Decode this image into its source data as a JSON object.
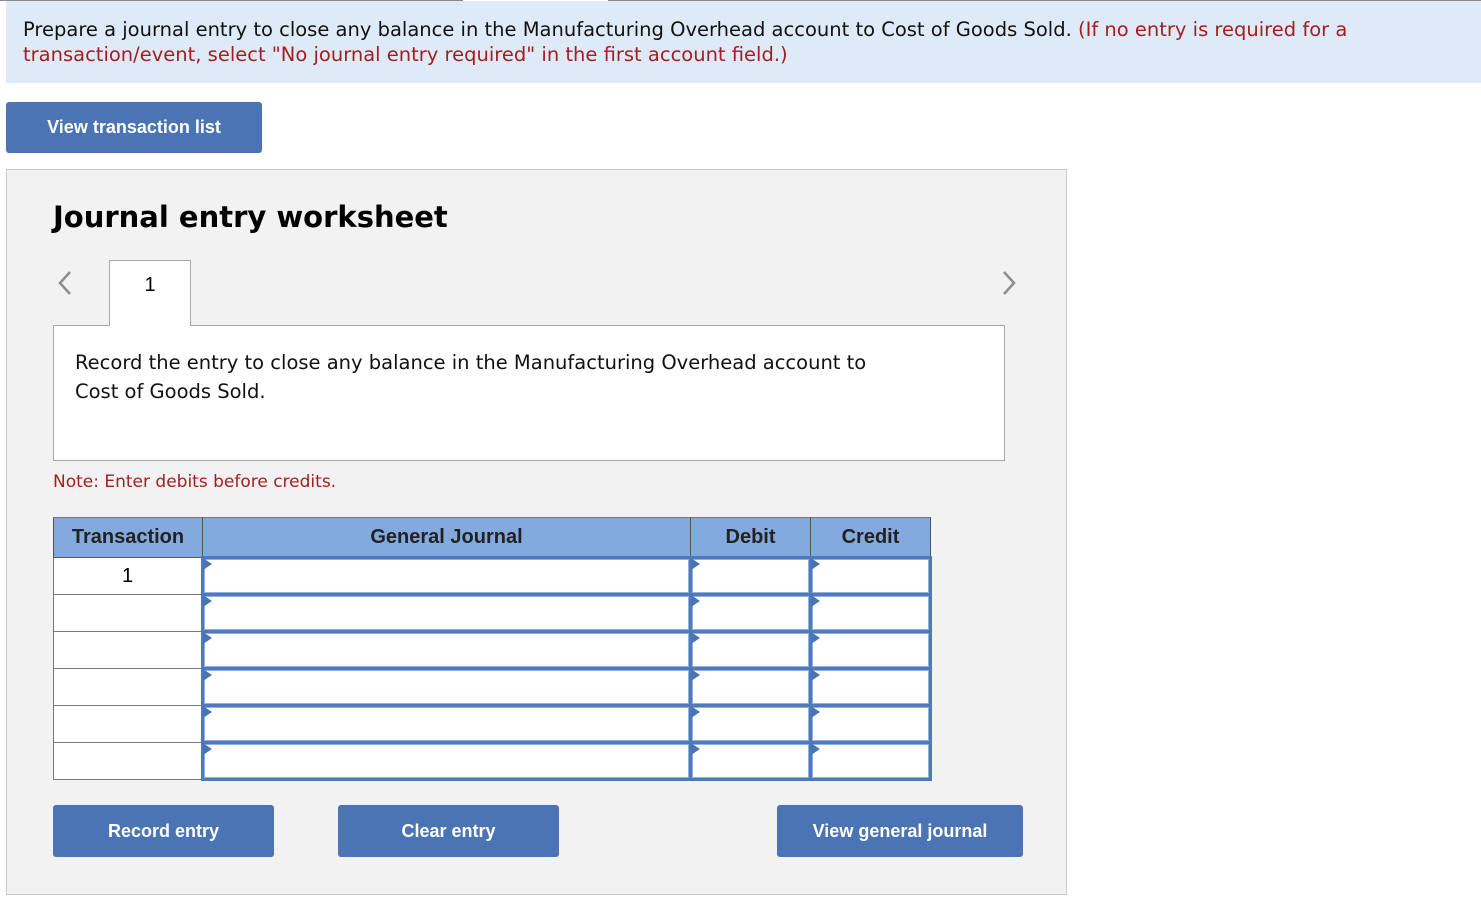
{
  "prompt": {
    "instruction": "Prepare a journal entry to close any balance in the Manufacturing Overhead account to Cost of Goods Sold.",
    "hint": "(If no entry is required for a transaction/event, select \"No journal entry required\" in the first account field.)"
  },
  "buttons": {
    "view_transaction_list": "View transaction list",
    "record_entry": "Record entry",
    "clear_entry": "Clear entry",
    "view_general_journal": "View general journal"
  },
  "worksheet": {
    "title": "Journal entry worksheet",
    "active_tab": "1",
    "description": "Record the entry to close any balance in the Manufacturing Overhead account to Cost of Goods Sold.",
    "note": "Note: Enter debits before credits."
  },
  "table": {
    "headers": [
      "Transaction",
      "General Journal",
      "Debit",
      "Credit"
    ],
    "rows": [
      {
        "transaction": "1",
        "account": "",
        "debit": "",
        "credit": ""
      },
      {
        "transaction": "",
        "account": "",
        "debit": "",
        "credit": ""
      },
      {
        "transaction": "",
        "account": "",
        "debit": "",
        "credit": ""
      },
      {
        "transaction": "",
        "account": "",
        "debit": "",
        "credit": ""
      },
      {
        "transaction": "",
        "account": "",
        "debit": "",
        "credit": ""
      },
      {
        "transaction": "",
        "account": "",
        "debit": "",
        "credit": ""
      }
    ]
  },
  "colors": {
    "accent": "#4a74b3",
    "header_bg": "#82aadf",
    "prompt_bg": "#deeaf7",
    "warning_text": "#a31f1f"
  }
}
